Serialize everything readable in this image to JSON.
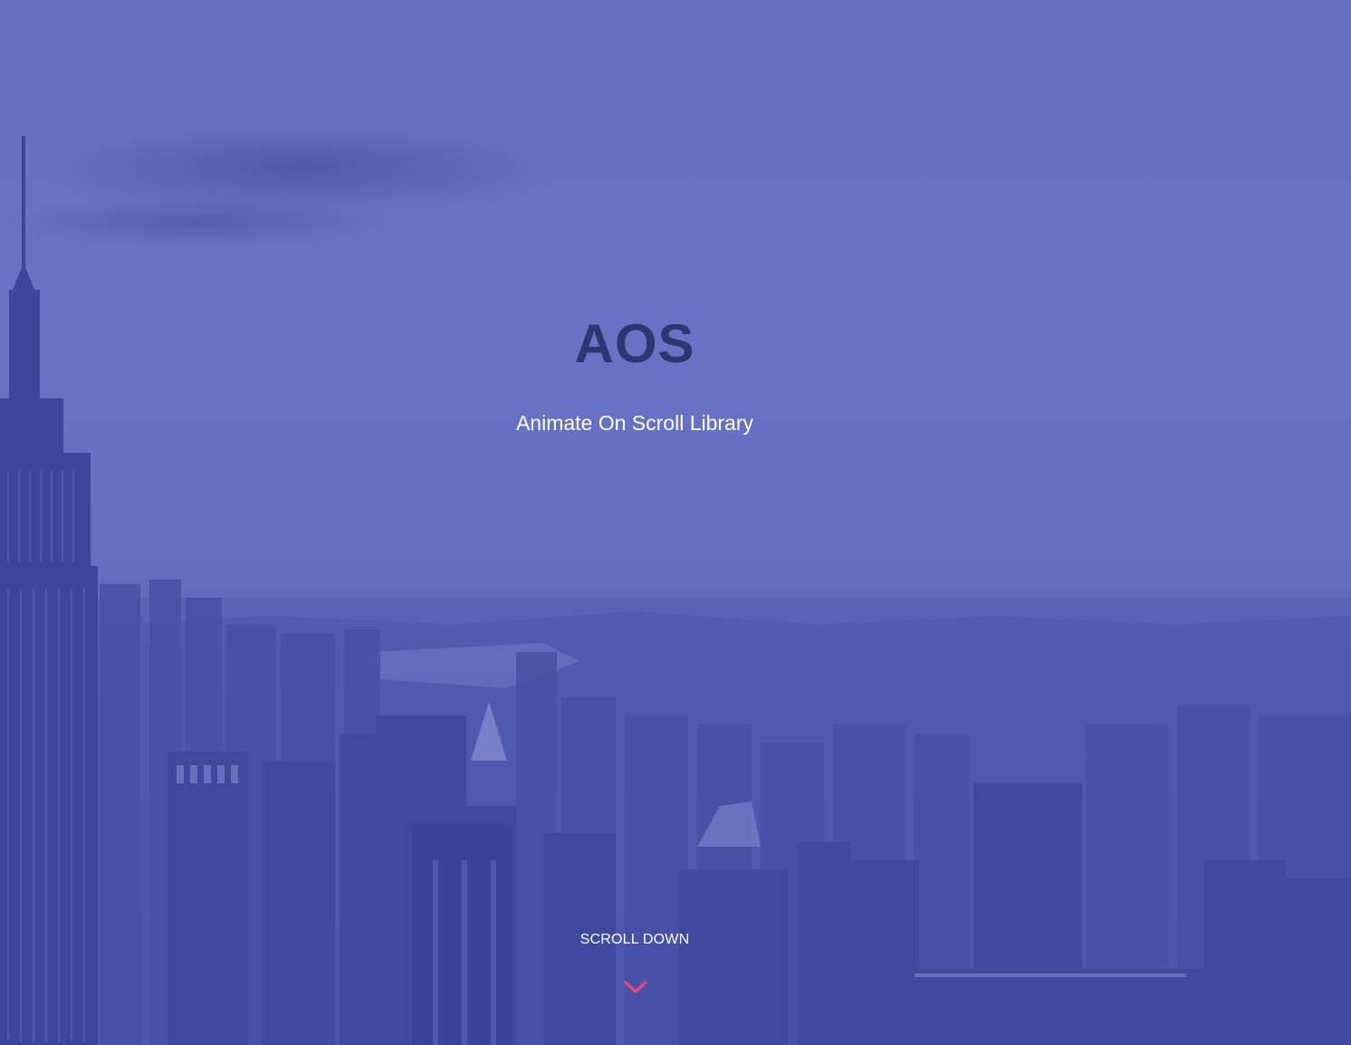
{
  "hero": {
    "title": "AOS",
    "subtitle": "Animate On Scroll Library",
    "scroll_label": "SCROLL DOWN",
    "chevron_icon": "chevron-down-icon"
  },
  "colors": {
    "background_overlay": "#5f69c0",
    "title": "#2e3870",
    "text": "#ffffff",
    "accent": "#e8457e"
  }
}
